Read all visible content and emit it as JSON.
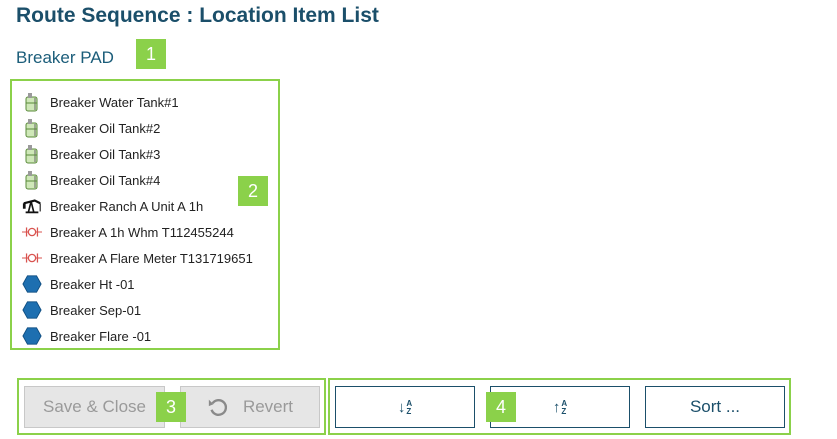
{
  "page": {
    "title": "Route Sequence : Location Item List",
    "location": "Breaker PAD"
  },
  "callouts": [
    "1",
    "2",
    "3",
    "4"
  ],
  "items": [
    {
      "label": "Breaker Water Tank#1",
      "icon": "tank-icon"
    },
    {
      "label": "Breaker Oil Tank#2",
      "icon": "tank-icon"
    },
    {
      "label": "Breaker Oil Tank#3",
      "icon": "tank-icon"
    },
    {
      "label": "Breaker Oil Tank#4",
      "icon": "tank-icon"
    },
    {
      "label": "Breaker Ranch A Unit A 1h",
      "icon": "pumpjack-icon"
    },
    {
      "label": "Breaker A 1h Whm T112455244",
      "icon": "meter-icon"
    },
    {
      "label": "Breaker A Flare Meter T131719651",
      "icon": "meter-icon"
    },
    {
      "label": "Breaker Ht -01",
      "icon": "hexagon-icon"
    },
    {
      "label": "Breaker Sep-01",
      "icon": "hexagon-icon"
    },
    {
      "label": "Breaker Flare -01",
      "icon": "hexagon-icon"
    }
  ],
  "buttons": {
    "save_close": "Save & Close",
    "revert": "Revert",
    "sort": "Sort ..."
  },
  "colors": {
    "accent_green": "#8bd14a",
    "title": "#1b4f6a",
    "hexagon": "#1e6fb0",
    "meter": "#d9534f"
  }
}
